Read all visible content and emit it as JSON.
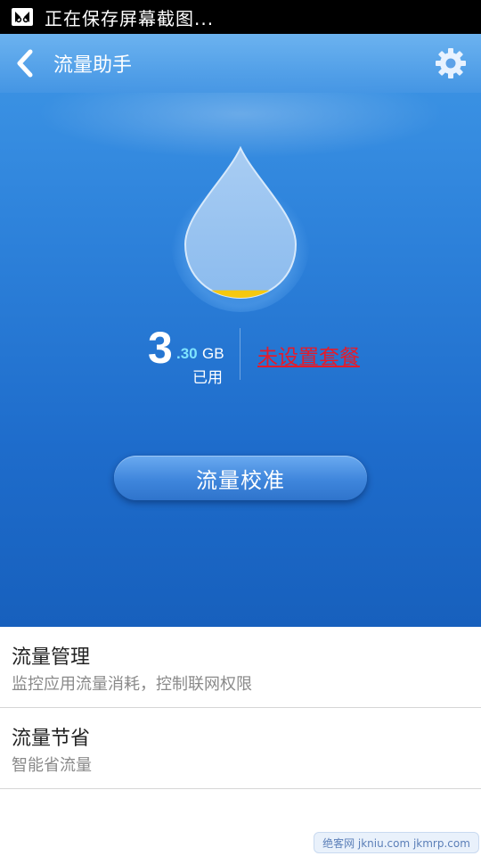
{
  "status_bar": {
    "notification_text": "正在保存屏幕截图..."
  },
  "header": {
    "title": "流量助手"
  },
  "usage": {
    "integer": "3",
    "decimal": ".30",
    "unit": "GB",
    "label": "已用",
    "fill_fraction": 0.05
  },
  "plan": {
    "link_text": "未设置套餐"
  },
  "calibrate": {
    "label": "流量校准"
  },
  "list": {
    "items": [
      {
        "title": "流量管理",
        "subtitle": "监控应用流量消耗，控制联网权限"
      },
      {
        "title": "流量节省",
        "subtitle": "智能省流量"
      }
    ]
  },
  "watermark": {
    "text": "绝客网 jkniu.com jkmrp.com"
  },
  "colors": {
    "hero_blue": "#2f84dc",
    "accent_cyan": "#7fe4ff",
    "plan_link_red": "#e51b2a",
    "fill_yellow": "#f6c80f"
  },
  "icons": {
    "status": "screenshot-icon",
    "back": "back-arrow-icon",
    "settings": "gear-icon"
  }
}
